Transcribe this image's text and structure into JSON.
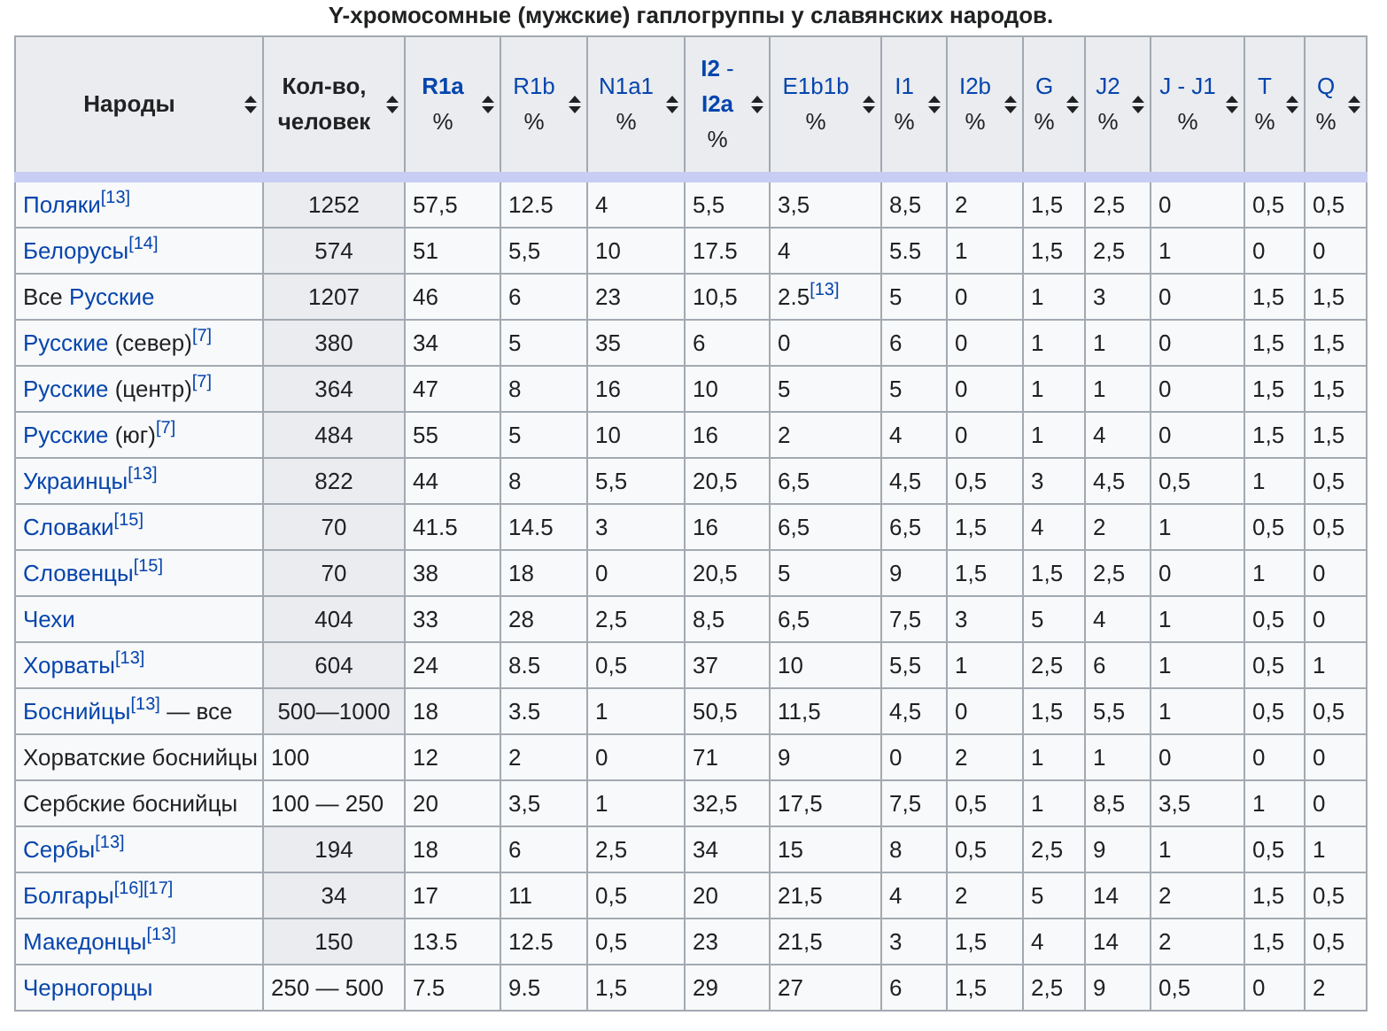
{
  "title": "Y-хромосомные (мужские) гаплогруппы у славянских народов.",
  "columns": [
    {
      "label": "Народы",
      "link": false,
      "bold": true
    },
    {
      "label": "Кол-во, человек",
      "link": false,
      "bold": true
    },
    {
      "label": "R1a",
      "unit": "%",
      "link": true,
      "bold": true
    },
    {
      "label": "R1b",
      "unit": "%",
      "link": true,
      "bold": false
    },
    {
      "label": "N1a1",
      "unit": "%",
      "link": true,
      "bold": false
    },
    {
      "label": "**I2** - **I2a**",
      "unit": "%",
      "link": true,
      "bold": false
    },
    {
      "label": "E1b1b",
      "unit": "%",
      "link": true,
      "bold": false
    },
    {
      "label": "I1",
      "unit": "%",
      "link": true,
      "bold": false
    },
    {
      "label": "I2b",
      "unit": "%",
      "link": true,
      "bold": false
    },
    {
      "label": "G",
      "unit": "%",
      "link": true,
      "bold": false
    },
    {
      "label": "J2",
      "unit": "%",
      "link": true,
      "bold": false
    },
    {
      "label": "J - J1",
      "unit": "%",
      "link": true,
      "bold": false
    },
    {
      "label": "T",
      "unit": "%",
      "link": true,
      "bold": false
    },
    {
      "label": "Q",
      "unit": "%",
      "link": true,
      "bold": false
    }
  ],
  "rows": [
    {
      "name": [
        {
          "text": "Поляки",
          "kind": "link"
        },
        {
          "text": "[13]",
          "kind": "ref"
        }
      ],
      "count": {
        "text": "1252",
        "shaded": true
      },
      "values": [
        "57,5",
        "12.5",
        "4",
        "5,5",
        "3,5",
        "8,5",
        "2",
        "1,5",
        "2,5",
        "0",
        "0,5",
        "0,5"
      ]
    },
    {
      "name": [
        {
          "text": "Белорусы",
          "kind": "link"
        },
        {
          "text": "[14]",
          "kind": "ref"
        }
      ],
      "count": {
        "text": "574",
        "shaded": true
      },
      "values": [
        "51",
        "5,5",
        "10",
        "17.5",
        "4",
        "5.5",
        "1",
        "1,5",
        "2,5",
        "1",
        "0",
        "0"
      ]
    },
    {
      "name": [
        {
          "text": "Все",
          "kind": "plain"
        },
        {
          "text": "Русские",
          "kind": "link"
        }
      ],
      "count": {
        "text": "1207",
        "shaded": true
      },
      "values": [
        "46",
        "6",
        "23",
        "10,5",
        "2.5$^{[13]}$",
        "5",
        "0",
        "1",
        "3",
        "0",
        "1,5",
        "1,5"
      ]
    },
    {
      "name": [
        {
          "text": "Русские",
          "kind": "link"
        },
        {
          "text": "(север)",
          "kind": "plain"
        },
        {
          "text": "[7]",
          "kind": "ref"
        }
      ],
      "count": {
        "text": "380",
        "shaded": true
      },
      "values": [
        "34",
        "5",
        "35",
        "6",
        "0",
        "6",
        "0",
        "1",
        "1",
        "0",
        "1,5",
        "1,5"
      ]
    },
    {
      "name": [
        {
          "text": "Русские",
          "kind": "link"
        },
        {
          "text": "(центр)",
          "kind": "plain"
        },
        {
          "text": "[7]",
          "kind": "ref"
        }
      ],
      "count": {
        "text": "364",
        "shaded": true
      },
      "values": [
        "47",
        "8",
        "16",
        "10",
        "5",
        "5",
        "0",
        "1",
        "1",
        "0",
        "1,5",
        "1,5"
      ]
    },
    {
      "name": [
        {
          "text": "Русские",
          "kind": "link"
        },
        {
          "text": "(юг)",
          "kind": "plain"
        },
        {
          "text": "[7]",
          "kind": "ref"
        }
      ],
      "count": {
        "text": "484",
        "shaded": true
      },
      "values": [
        "55",
        "5",
        "10",
        "16",
        "2",
        "4",
        "0",
        "1",
        "4",
        "0",
        "1,5",
        "1,5"
      ]
    },
    {
      "name": [
        {
          "text": "Украинцы",
          "kind": "link"
        },
        {
          "text": "[13]",
          "kind": "ref"
        }
      ],
      "count": {
        "text": "822",
        "shaded": true
      },
      "values": [
        "44",
        "8",
        "5,5",
        "20,5",
        "6,5",
        "4,5",
        "0,5",
        "3",
        "4,5",
        "0,5",
        "1",
        "0,5"
      ]
    },
    {
      "name": [
        {
          "text": "Словаки",
          "kind": "link"
        },
        {
          "text": "[15]",
          "kind": "ref"
        }
      ],
      "count": {
        "text": "70",
        "shaded": true
      },
      "values": [
        "41.5",
        "14.5",
        "3",
        "16",
        "6,5",
        "6,5",
        "1,5",
        "4",
        "2",
        "1",
        "0,5",
        "0,5"
      ]
    },
    {
      "name": [
        {
          "text": "Словенцы",
          "kind": "link"
        },
        {
          "text": "[15]",
          "kind": "ref"
        }
      ],
      "count": {
        "text": "70",
        "shaded": true
      },
      "values": [
        "38",
        "18",
        "0",
        "20,5",
        "5",
        "9",
        "1,5",
        "1,5",
        "2,5",
        "0",
        "1",
        "0"
      ]
    },
    {
      "name": [
        {
          "text": "Чехи",
          "kind": "link"
        }
      ],
      "count": {
        "text": "404",
        "shaded": true
      },
      "values": [
        "33",
        "28",
        "2,5",
        "8,5",
        "6,5",
        "7,5",
        "3",
        "5",
        "4",
        "1",
        "0,5",
        "0"
      ]
    },
    {
      "name": [
        {
          "text": "Хорваты",
          "kind": "link"
        },
        {
          "text": "[13]",
          "kind": "ref"
        }
      ],
      "count": {
        "text": "604",
        "shaded": true
      },
      "values": [
        "24",
        "8.5",
        "0,5",
        "37",
        "10",
        "5,5",
        "1",
        "2,5",
        "6",
        "1",
        "0,5",
        "1"
      ]
    },
    {
      "name": [
        {
          "text": "Боснийцы",
          "kind": "link"
        },
        {
          "text": "[13]",
          "kind": "ref"
        },
        {
          "text": "— все",
          "kind": "plain"
        }
      ],
      "count": {
        "text": "500—1000",
        "shaded": true
      },
      "values": [
        "18",
        "3.5",
        "1",
        "50,5",
        "11,5",
        "4,5",
        "0",
        "1,5",
        "5,5",
        "1",
        "0,5",
        "0,5"
      ]
    },
    {
      "name": [
        {
          "text": "Хорватские боснийцы",
          "kind": "plain"
        }
      ],
      "count": {
        "text": "100",
        "shaded": false
      },
      "values": [
        "12",
        "2",
        "0",
        "71",
        "9",
        "0",
        "2",
        "1",
        "1",
        "0",
        "0",
        "0"
      ]
    },
    {
      "name": [
        {
          "text": "Сербские боснийцы",
          "kind": "plain"
        }
      ],
      "count": {
        "text": "100 — 250",
        "shaded": false
      },
      "values": [
        "20",
        "3,5",
        "1",
        "32,5",
        "17,5",
        "7,5",
        "0,5",
        "1",
        "8,5",
        "3,5",
        "1",
        "0"
      ]
    },
    {
      "name": [
        {
          "text": "Сербы",
          "kind": "link"
        },
        {
          "text": "[13]",
          "kind": "ref"
        }
      ],
      "count": {
        "text": "194",
        "shaded": true
      },
      "values": [
        "18",
        "6",
        "2,5",
        "34",
        "15",
        "8",
        "0,5",
        "2,5",
        "9",
        "1",
        "0,5",
        "1"
      ]
    },
    {
      "name": [
        {
          "text": "Болгары",
          "kind": "link"
        },
        {
          "text": "[16]",
          "kind": "ref"
        },
        {
          "text": "[17]",
          "kind": "ref"
        }
      ],
      "count": {
        "text": "34",
        "shaded": true
      },
      "values": [
        "17",
        "11",
        "0,5",
        "20",
        "21,5",
        "4",
        "2",
        "5",
        "14",
        "2",
        "1,5",
        "0,5"
      ]
    },
    {
      "name": [
        {
          "text": "Македонцы",
          "kind": "link"
        },
        {
          "text": "[13]",
          "kind": "ref"
        }
      ],
      "count": {
        "text": "150",
        "shaded": true
      },
      "values": [
        "13.5",
        "12.5",
        "0,5",
        "23",
        "21,5",
        "3",
        "1,5",
        "4",
        "14",
        "2",
        "1,5",
        "0,5"
      ]
    },
    {
      "name": [
        {
          "text": "Черногорцы",
          "kind": "link"
        }
      ],
      "count": {
        "text": "250 — 500",
        "shaded": false
      },
      "values": [
        "7.5",
        "9.5",
        "1,5",
        "29",
        "27",
        "6",
        "1,5",
        "2,5",
        "9",
        "0,5",
        "0",
        "2"
      ]
    }
  ]
}
